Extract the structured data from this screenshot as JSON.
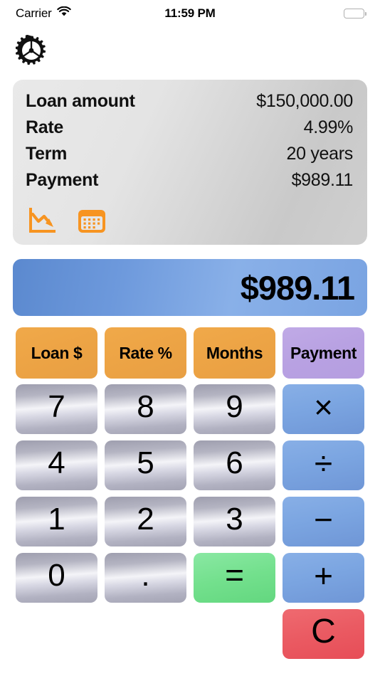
{
  "status_bar": {
    "carrier": "Carrier",
    "wifi_icon": "wifi-icon",
    "time": "11:59 PM",
    "battery_icon": "battery-full-icon"
  },
  "toolbar": {
    "settings_icon": "gear-icon"
  },
  "summary_panel": {
    "rows": [
      {
        "label": "Loan amount",
        "value": "$150,000.00"
      },
      {
        "label": "Rate",
        "value": "4.99%"
      },
      {
        "label": "Term",
        "value": "20 years"
      },
      {
        "label": "Payment",
        "value": "$989.11"
      }
    ],
    "icons": [
      {
        "name": "chart-decline-icon",
        "color": "#f79421"
      },
      {
        "name": "amortization-table-icon",
        "color": "#f79421"
      }
    ]
  },
  "display": {
    "value": "$989.11",
    "background_start": "#5b89cf",
    "background_end": "#89b0e8"
  },
  "function_keys": [
    {
      "label": "Loan $",
      "name": "loan-amount-button",
      "color": "#eda445"
    },
    {
      "label": "Rate %",
      "name": "rate-percent-button",
      "color": "#eda445"
    },
    {
      "label": "Months",
      "name": "months-button",
      "color": "#eda445"
    },
    {
      "label": "Payment",
      "name": "payment-button",
      "color": "#b8a1e2"
    }
  ],
  "keypad": {
    "rows": [
      [
        {
          "label": "7",
          "name": "key-7",
          "kind": "num"
        },
        {
          "label": "8",
          "name": "key-8",
          "kind": "num"
        },
        {
          "label": "9",
          "name": "key-9",
          "kind": "num"
        },
        {
          "label": "×",
          "name": "key-multiply",
          "kind": "op"
        }
      ],
      [
        {
          "label": "4",
          "name": "key-4",
          "kind": "num"
        },
        {
          "label": "5",
          "name": "key-5",
          "kind": "num"
        },
        {
          "label": "6",
          "name": "key-6",
          "kind": "num"
        },
        {
          "label": "÷",
          "name": "key-divide",
          "kind": "op"
        }
      ],
      [
        {
          "label": "1",
          "name": "key-1",
          "kind": "num"
        },
        {
          "label": "2",
          "name": "key-2",
          "kind": "num"
        },
        {
          "label": "3",
          "name": "key-3",
          "kind": "num"
        },
        {
          "label": "−",
          "name": "key-minus",
          "kind": "op"
        }
      ],
      [
        {
          "label": "0",
          "name": "key-0",
          "kind": "num"
        },
        {
          "label": ".",
          "name": "key-decimal",
          "kind": "num"
        },
        {
          "label": "=",
          "name": "key-equals",
          "kind": "eq"
        },
        {
          "label": "+",
          "name": "key-plus",
          "kind": "op"
        }
      ],
      [
        {
          "label": "",
          "name": "key-spacer-1",
          "kind": "spacer"
        },
        {
          "label": "",
          "name": "key-spacer-2",
          "kind": "spacer"
        },
        {
          "label": "",
          "name": "key-spacer-3",
          "kind": "spacer"
        },
        {
          "label": "C",
          "name": "key-clear",
          "kind": "clear"
        }
      ]
    ]
  },
  "colors": {
    "orange_accent": "#f79421",
    "blue_operator": "#7ba5e1",
    "green_equals": "#73e08d",
    "red_clear": "#ea5a62",
    "purple_payment": "#b8a1e2"
  }
}
